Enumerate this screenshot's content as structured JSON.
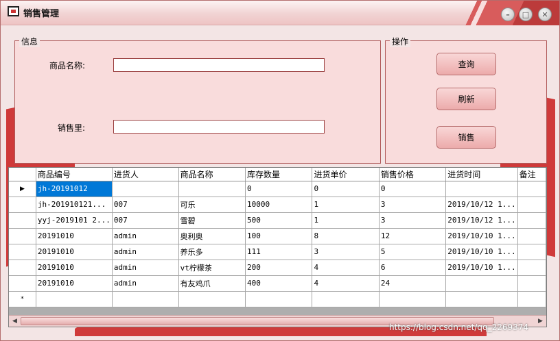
{
  "window": {
    "title": "销售管理",
    "controls": {
      "minimize": "–",
      "maximize": "□",
      "close": "✕"
    }
  },
  "info_group": {
    "legend": "信息",
    "name_label": "商品名称:",
    "name_value": "",
    "qty_label": "销售里:",
    "qty_value": ""
  },
  "op_group": {
    "legend": "操作",
    "query_label": "查询",
    "refresh_label": "刷新",
    "sell_label": "销售"
  },
  "grid": {
    "columns": [
      "商品编号",
      "进货人",
      "商品名称",
      "库存数量",
      "进货单价",
      "销售价格",
      "进货时间",
      "备注"
    ],
    "rows": [
      {
        "marker": "▶",
        "cells": [
          "jh-20191012",
          "",
          "",
          "0",
          "0",
          "0",
          "",
          ""
        ]
      },
      {
        "marker": "",
        "cells": [
          "jh-201910121...",
          "007",
          "可乐",
          "10000",
          "1",
          "3",
          "2019/10/12 1...",
          ""
        ]
      },
      {
        "marker": "",
        "cells": [
          "yyj-2019101 2...",
          "007",
          "雪碧",
          "500",
          "1",
          "3",
          "2019/10/12 1...",
          ""
        ]
      },
      {
        "marker": "",
        "cells": [
          "20191010",
          "admin",
          "奥利奥",
          "100",
          "8",
          "12",
          "2019/10/10 1...",
          ""
        ]
      },
      {
        "marker": "",
        "cells": [
          "20191010",
          "admin",
          "养乐多",
          "111",
          "3",
          "5",
          "2019/10/10 1...",
          ""
        ]
      },
      {
        "marker": "",
        "cells": [
          "20191010",
          "admin",
          "vt柠檬茶",
          "200",
          "4",
          "6",
          "2019/10/10 1...",
          ""
        ]
      },
      {
        "marker": "",
        "cells": [
          "20191010",
          "admin",
          "有友鸡爪",
          "400",
          "4",
          "24",
          "",
          ""
        ]
      },
      {
        "marker": "*",
        "cells": [
          "",
          "",
          "",
          "",
          "",
          "",
          "",
          ""
        ]
      }
    ]
  },
  "watermark": "https://blog.csdn.net/qq_2269374"
}
